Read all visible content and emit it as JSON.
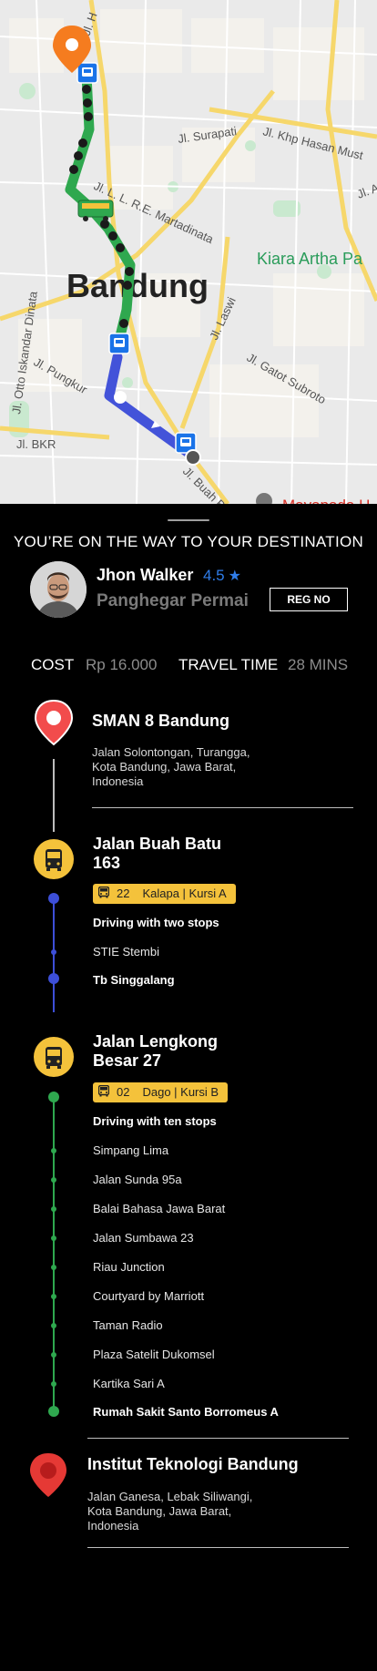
{
  "map": {
    "city_label": "Bandung",
    "area_label": "Kiara Artha Pa",
    "streets": [
      "Jl. Surapati",
      "Jl. Khp Hasan Must",
      "Jl. L. L. R.E. Martadinata",
      "Jl. Otto Iskandar Dinata",
      "Jl. Pungkur",
      "Jl. BKR",
      "Jl. Laswi",
      "Jl. Gatot Subroto",
      "Jl. Buah Ba",
      "Jl. H",
      "Jl. A"
    ],
    "poi_label": "Mayapada H",
    "colors": {
      "route_green": "#2fa84f",
      "route_blue": "#4353d9",
      "pin": "#f57c1f",
      "bus_stop": "#1a73e8"
    }
  },
  "trip": {
    "banner": "YOU’RE ON THE WAY TO YOUR DESTINATION",
    "driver": {
      "name": "Jhon Walker",
      "rating": "4.5",
      "rating_icon": "star-icon",
      "location": "Panghegar Permai",
      "reg_button": "REG NO"
    },
    "cost_label": "COST",
    "cost_value": "Rp 16.000",
    "time_label": "TRAVEL TIME",
    "time_value": "28 MINS"
  },
  "itinerary": {
    "origin": {
      "title": "SMAN 8 Bandung",
      "address": [
        "Jalan Solontongan, Turangga,",
        "Kota Bandung, Jawa Barat,",
        "Indonesia"
      ]
    },
    "leg1": {
      "title": [
        "Jalan Buah Batu",
        "163"
      ],
      "route_number": "22",
      "route_name": "Kalapa | Kursi A",
      "driving_text": "Driving with two stops",
      "stops": [
        "STIE Stembi"
      ],
      "end_stop": "Tb Singgalang"
    },
    "leg2": {
      "title": [
        "Jalan Lengkong",
        "Besar 27"
      ],
      "route_number": "02",
      "route_name": "Dago | Kursi B",
      "driving_text": "Driving with ten stops",
      "stops": [
        "Simpang Lima",
        "Jalan Sunda 95a",
        "Balai Bahasa Jawa Barat",
        "Jalan Sumbawa 23",
        "Riau Junction",
        "Courtyard by Marriott",
        "Taman Radio",
        "Plaza Satelit Dukomsel",
        "Kartika Sari A"
      ],
      "end_stop": "Rumah Sakit Santo Borromeus A"
    },
    "destination": {
      "title": "Institut Teknologi Bandung",
      "address": [
        "Jalan Ganesa, Lebak Siliwangi,",
        "Kota Bandung, Jawa Barat,",
        "Indonesia"
      ]
    }
  }
}
